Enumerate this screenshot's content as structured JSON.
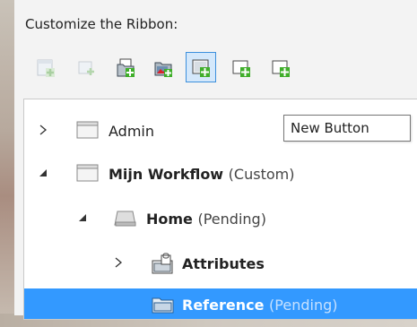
{
  "panel": {
    "title": "Customize the Ribbon:"
  },
  "toolbar": {
    "buttons": [
      {
        "icon": "new-tab-icon",
        "state": "disabled"
      },
      {
        "icon": "new-group-icon",
        "state": "disabled"
      },
      {
        "icon": "new-category-icon",
        "state": "enabled"
      },
      {
        "icon": "new-item-icon",
        "state": "enabled"
      },
      {
        "icon": "new-button-icon",
        "state": "hovered"
      },
      {
        "icon": "new-dropdown-icon",
        "state": "enabled"
      },
      {
        "icon": "new-toggle-icon",
        "state": "enabled"
      }
    ],
    "tooltip": "New Button"
  },
  "tree": {
    "items": [
      {
        "label": "Admin",
        "suffix": ""
      },
      {
        "label": "Mijn Workflow",
        "suffix": "(Custom)"
      },
      {
        "label": "Home",
        "suffix": "(Pending)"
      },
      {
        "label": "Attributes",
        "suffix": ""
      },
      {
        "label": "Reference",
        "suffix": "(Pending)"
      }
    ]
  },
  "colors": {
    "selection": "#3399ff",
    "hover_border": "#3c8fdc",
    "green_plus": "#3fae2a",
    "red_mark": "#d8232a"
  }
}
